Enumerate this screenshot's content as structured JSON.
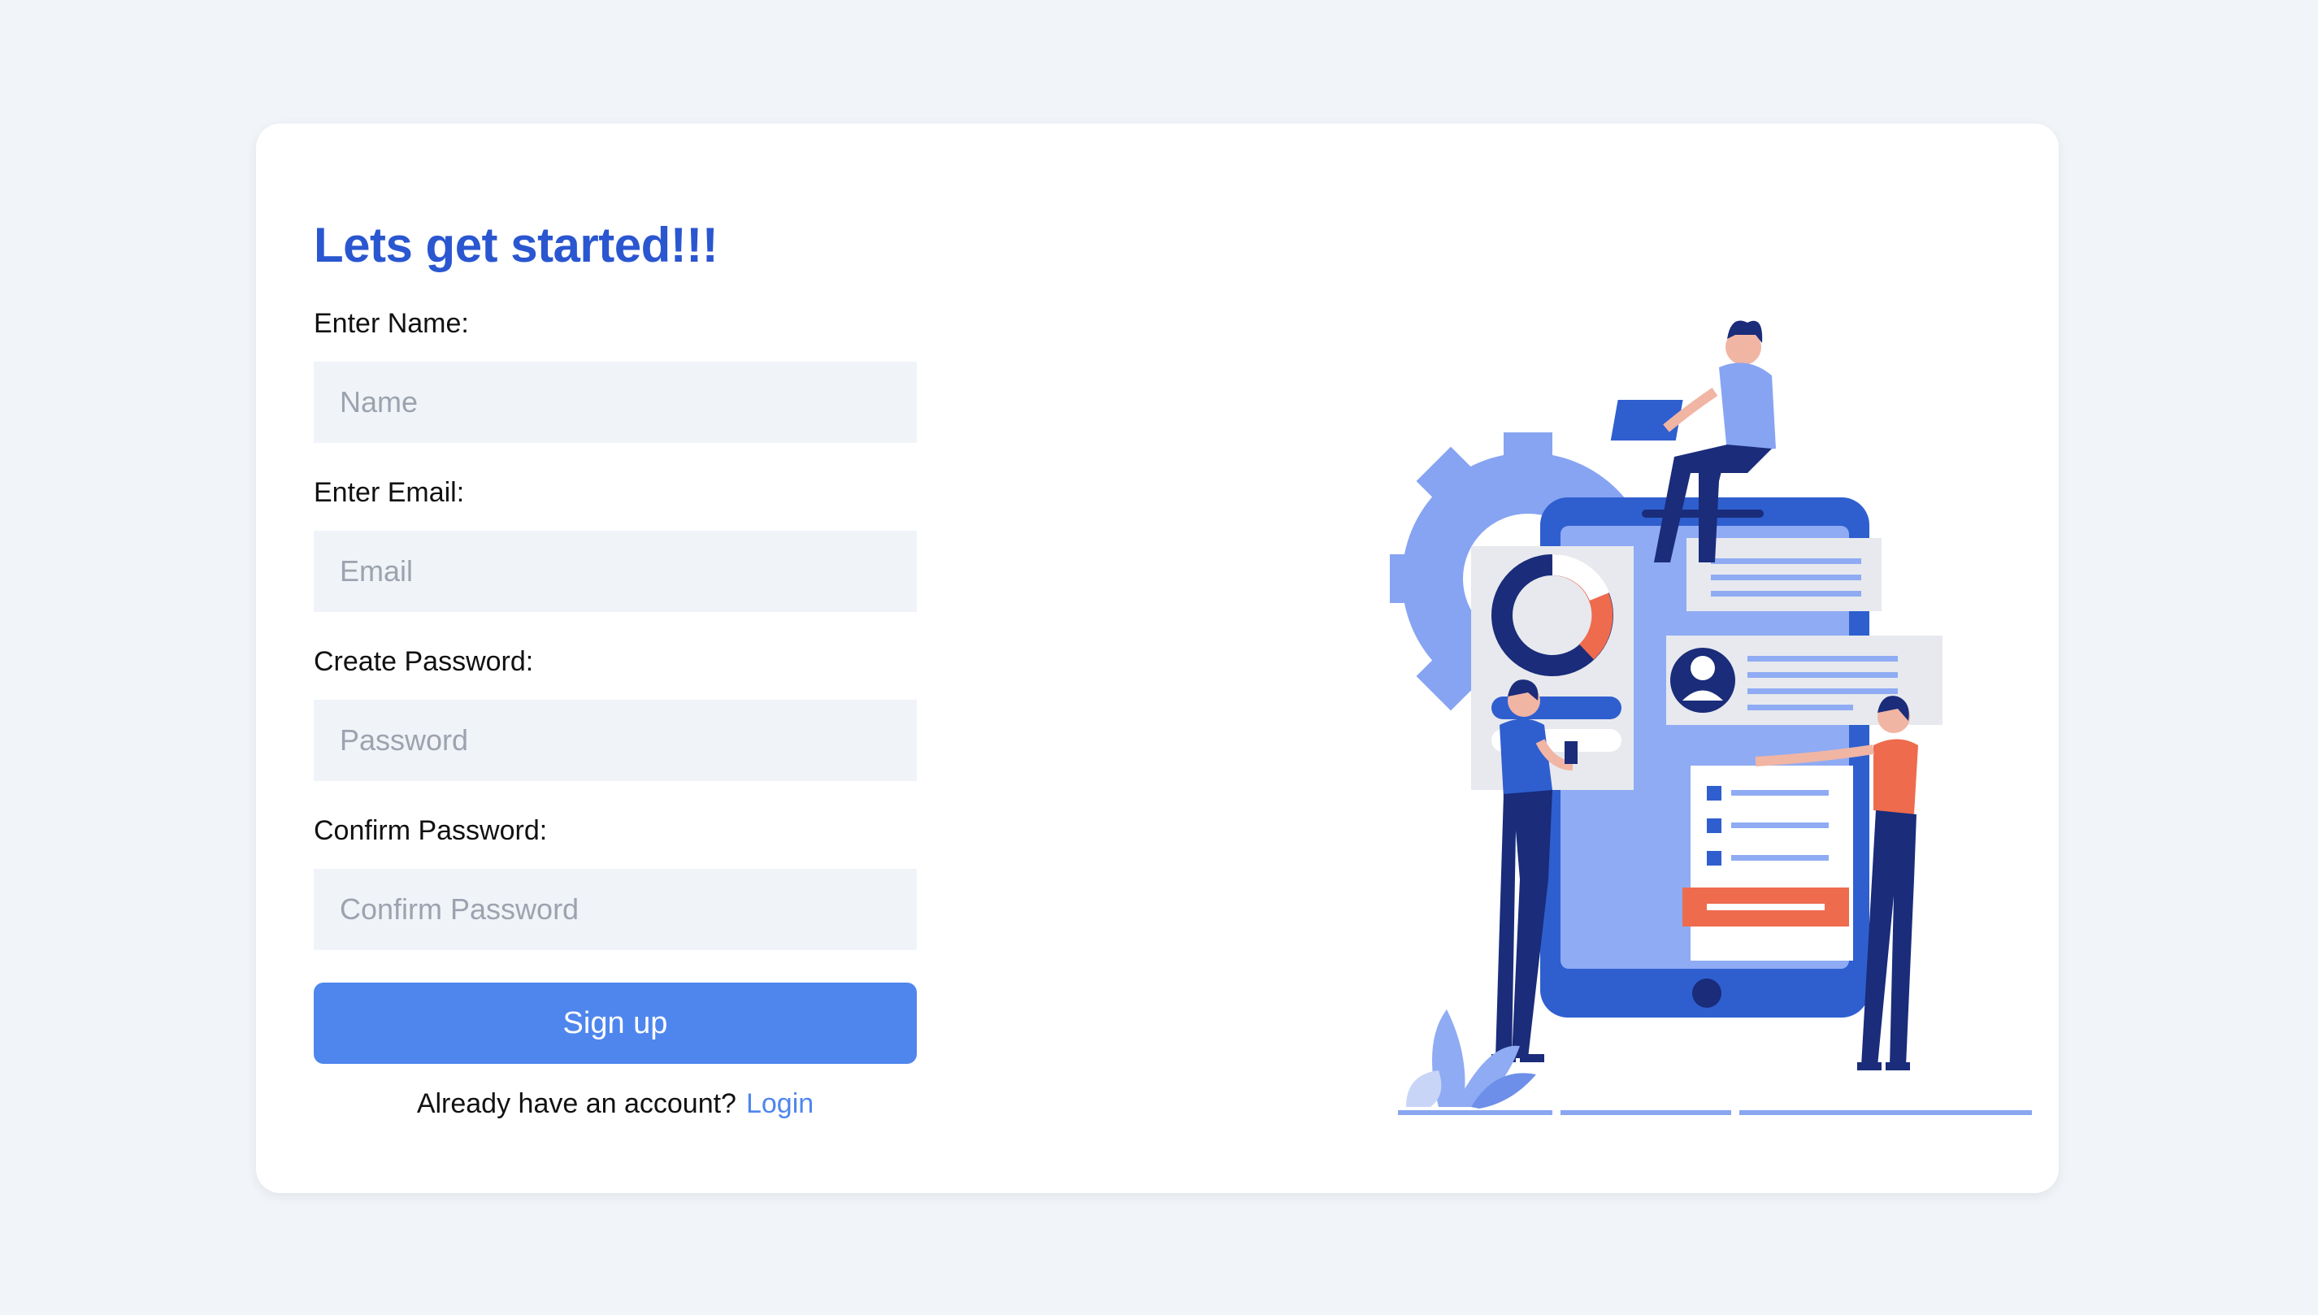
{
  "form": {
    "title": "Lets get started!!!",
    "name_label": "Enter Name:",
    "name_placeholder": "Name",
    "email_label": "Enter Email:",
    "email_placeholder": "Email",
    "password_label": "Create Password:",
    "password_placeholder": "Password",
    "confirm_label": "Confirm Password:",
    "confirm_placeholder": "Confirm Password",
    "submit_label": "Sign up",
    "footer_text": "Already have an account?",
    "login_link": "Login"
  },
  "colors": {
    "page_background": "#f1f4f9",
    "title": "#2a56d0",
    "button": "#4e86ed",
    "input_background": "#f0f3f8"
  },
  "illustration": {
    "icon": "mobile-app-team-illustration"
  }
}
